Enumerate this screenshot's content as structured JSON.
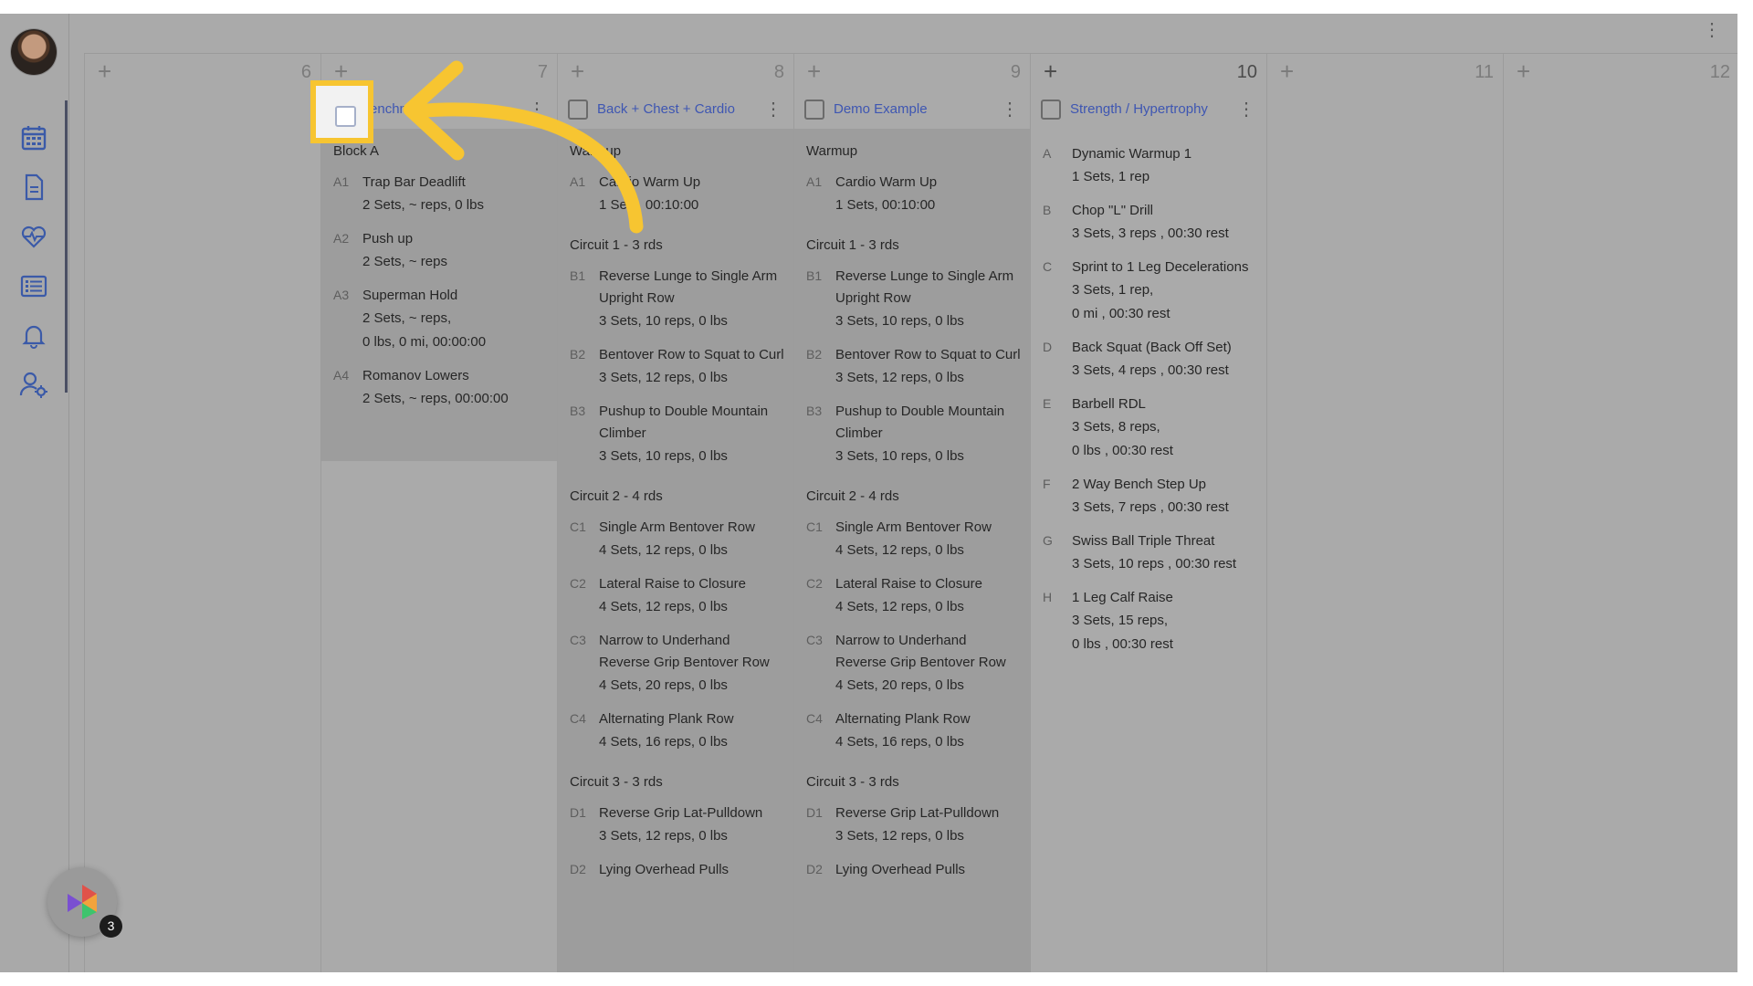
{
  "header": {
    "menu_icon": "⋮"
  },
  "sidebar": {
    "avatar_alt": "User avatar",
    "icons": [
      "calendar-icon",
      "document-icon",
      "heart-rate-icon",
      "list-icon",
      "bell-icon",
      "user-settings-icon"
    ]
  },
  "days": [
    {
      "number": "6",
      "add": "+"
    },
    {
      "number": "7",
      "add": "+"
    },
    {
      "number": "8",
      "add": "+"
    },
    {
      "number": "9",
      "add": "+"
    },
    {
      "number": "10",
      "add": "+"
    },
    {
      "number": "11",
      "add": "+"
    },
    {
      "number": "12",
      "add": "+"
    }
  ],
  "workouts": {
    "benchmark": {
      "title": "Benchm",
      "menu": "⋮",
      "blocks": [
        {
          "title": "Block A",
          "exercises": [
            {
              "code": "A1",
              "name": "Trap Bar Deadlift",
              "details": [
                "2 Sets, ~ reps, 0 lbs"
              ]
            },
            {
              "code": "A2",
              "name": "Push up",
              "details": [
                "2 Sets, ~ reps"
              ]
            },
            {
              "code": "A3",
              "name": "Superman Hold",
              "details": [
                "2 Sets, ~ reps,",
                "0 lbs, 0 mi, 00:00:00"
              ]
            },
            {
              "code": "A4",
              "name": "Romanov Lowers",
              "details": [
                "2 Sets, ~ reps, 00:00:00"
              ]
            }
          ]
        }
      ]
    },
    "back_chest_cardio": {
      "title": "Back + Chest + Cardio",
      "menu": "⋮",
      "blocks": [
        {
          "title": "Warmup",
          "exercises": [
            {
              "code": "A1",
              "name": "Cardio Warm Up",
              "details": [
                "1 Sets, 00:10:00"
              ]
            }
          ]
        },
        {
          "title": "Circuit 1 - 3 rds",
          "exercises": [
            {
              "code": "B1",
              "name": "Reverse Lunge to Single Arm Upright Row",
              "details": [
                "3 Sets, 10 reps, 0 lbs"
              ]
            },
            {
              "code": "B2",
              "name": "Bentover Row to Squat to Curl",
              "details": [
                "3 Sets, 12 reps, 0 lbs"
              ]
            },
            {
              "code": "B3",
              "name": "Pushup to Double Mountain Climber",
              "details": [
                "3 Sets, 10 reps, 0 lbs"
              ]
            }
          ]
        },
        {
          "title": "Circuit 2 - 4 rds",
          "exercises": [
            {
              "code": "C1",
              "name": "Single Arm Bentover Row",
              "details": [
                "4 Sets, 12 reps, 0 lbs"
              ]
            },
            {
              "code": "C2",
              "name": "Lateral Raise to Closure",
              "details": [
                "4 Sets, 12 reps, 0 lbs"
              ]
            },
            {
              "code": "C3",
              "name": "Narrow to Underhand Reverse Grip Bentover Row",
              "details": [
                "4 Sets, 20 reps, 0 lbs"
              ]
            },
            {
              "code": "C4",
              "name": "Alternating Plank Row",
              "details": [
                "4 Sets, 16 reps, 0 lbs"
              ]
            }
          ]
        },
        {
          "title": "Circuit 3 - 3 rds",
          "exercises": [
            {
              "code": "D1",
              "name": "Reverse Grip Lat-Pulldown",
              "details": [
                "3 Sets, 12 reps, 0 lbs"
              ]
            },
            {
              "code": "D2",
              "name": "Lying Overhead Pulls",
              "details": []
            }
          ]
        }
      ]
    },
    "demo_example": {
      "title": "Demo Example",
      "menu": "⋮",
      "blocks": [
        {
          "title": "Warmup",
          "exercises": [
            {
              "code": "A1",
              "name": "Cardio Warm Up",
              "details": [
                "1 Sets, 00:10:00"
              ]
            }
          ]
        },
        {
          "title": "Circuit 1 - 3 rds",
          "exercises": [
            {
              "code": "B1",
              "name": "Reverse Lunge to Single Arm Upright Row",
              "details": [
                "3 Sets, 10 reps, 0 lbs"
              ]
            },
            {
              "code": "B2",
              "name": "Bentover Row to Squat to Curl",
              "details": [
                "3 Sets, 12 reps, 0 lbs"
              ]
            },
            {
              "code": "B3",
              "name": "Pushup to Double Mountain Climber",
              "details": [
                "3 Sets, 10 reps, 0 lbs"
              ]
            }
          ]
        },
        {
          "title": "Circuit 2 - 4 rds",
          "exercises": [
            {
              "code": "C1",
              "name": "Single Arm Bentover Row",
              "details": [
                "4 Sets, 12 reps, 0 lbs"
              ]
            },
            {
              "code": "C2",
              "name": "Lateral Raise to Closure",
              "details": [
                "4 Sets, 12 reps, 0 lbs"
              ]
            },
            {
              "code": "C3",
              "name": "Narrow to Underhand Reverse Grip Bentover Row",
              "details": [
                "4 Sets, 20 reps, 0 lbs"
              ]
            },
            {
              "code": "C4",
              "name": "Alternating Plank Row",
              "details": [
                "4 Sets, 16 reps, 0 lbs"
              ]
            }
          ]
        },
        {
          "title": "Circuit 3 - 3 rds",
          "exercises": [
            {
              "code": "D1",
              "name": "Reverse Grip Lat-Pulldown",
              "details": [
                "3 Sets, 12 reps, 0 lbs"
              ]
            },
            {
              "code": "D2",
              "name": "Lying Overhead Pulls",
              "details": []
            }
          ]
        }
      ]
    },
    "strength_hypertrophy": {
      "title": "Strength / Hypertrophy",
      "menu": "⋮",
      "blocks": [
        {
          "title": "",
          "exercises": [
            {
              "code": "A",
              "name": "Dynamic Warmup 1",
              "details": [
                "1 Sets, 1 rep"
              ]
            },
            {
              "code": "B",
              "name": "Chop \"L\" Drill",
              "details": [
                "3 Sets, 3 reps , 00:30 rest"
              ]
            },
            {
              "code": "C",
              "name": "Sprint to 1 Leg Decelerations",
              "details": [
                "3 Sets, 1 rep,",
                "0 mi , 00:30 rest"
              ]
            },
            {
              "code": "D",
              "name": "Back Squat (Back Off Set)",
              "details": [
                "3 Sets, 4 reps , 00:30 rest"
              ]
            },
            {
              "code": "E",
              "name": "Barbell RDL",
              "details": [
                "3 Sets, 8 reps,",
                "0 lbs , 00:30 rest"
              ]
            },
            {
              "code": "F",
              "name": "2 Way Bench Step Up",
              "details": [
                "3 Sets, 7 reps , 00:30 rest"
              ]
            },
            {
              "code": "G",
              "name": "Swiss Ball Triple Threat",
              "details": [
                "3 Sets, 10 reps , 00:30 rest"
              ]
            },
            {
              "code": "H",
              "name": "1 Leg Calf Raise",
              "details": [
                "3 Sets, 15 reps,",
                "0 lbs , 00:30 rest"
              ]
            }
          ]
        }
      ]
    }
  },
  "help_widget": {
    "badge_count": "3"
  },
  "colors": {
    "highlight": "#f7c531",
    "link": "#3e56b2",
    "overlay": "#aaaaaa"
  }
}
